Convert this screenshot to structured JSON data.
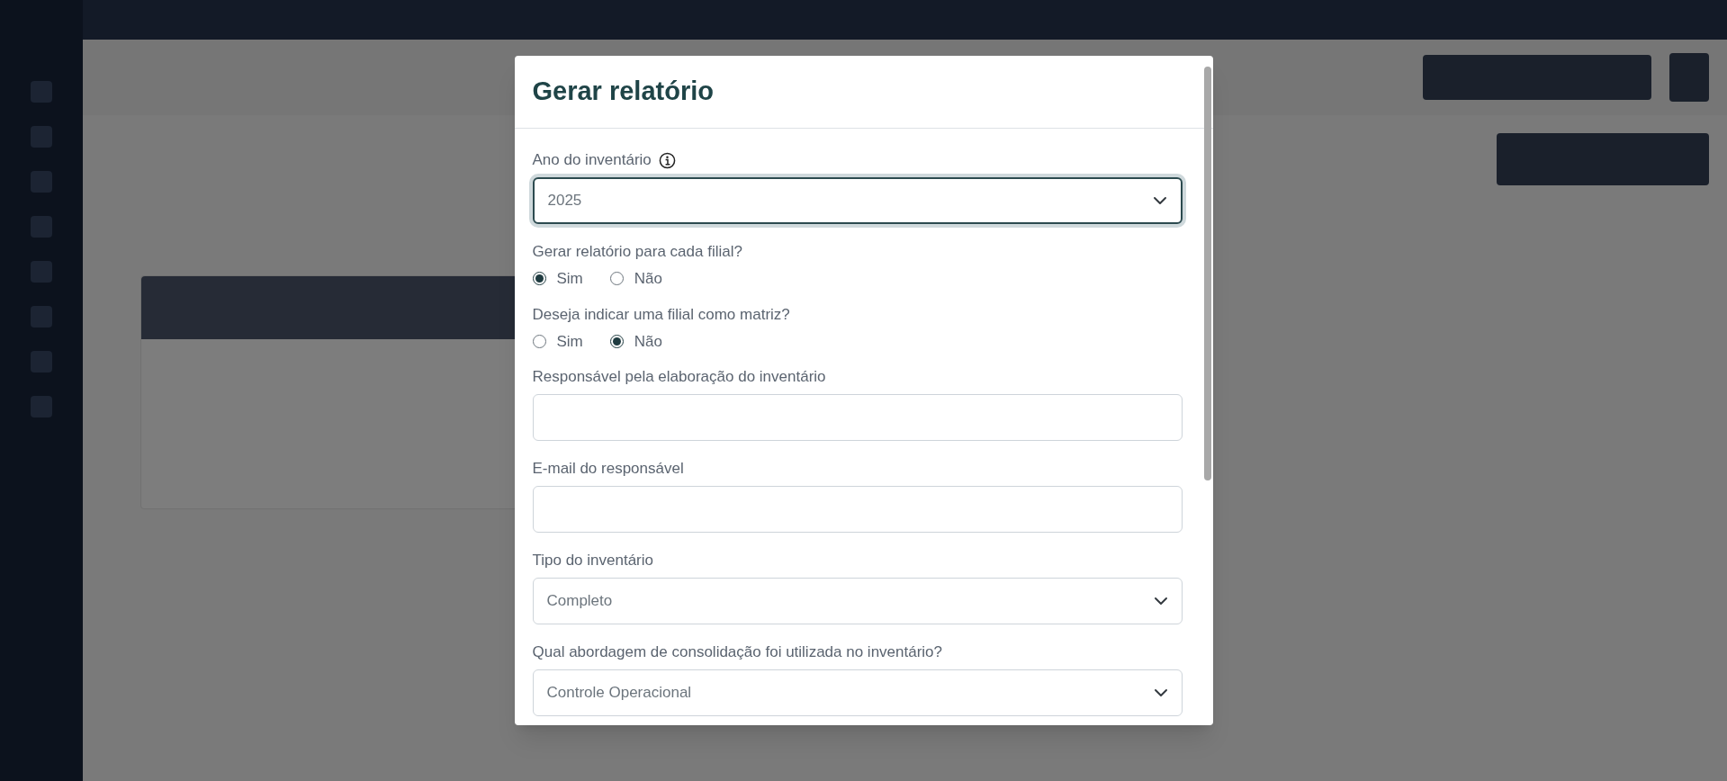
{
  "modal": {
    "title": "Gerar relatório",
    "fields": [
      {
        "kind": "select",
        "label": "Ano do inventário",
        "info": true,
        "value": "2025",
        "focused": true
      },
      {
        "kind": "radio",
        "label": "Gerar relatório para cada filial?",
        "options": [
          {
            "label": "Sim",
            "selected": true
          },
          {
            "label": "Não",
            "selected": false
          }
        ]
      },
      {
        "kind": "radio",
        "label": "Deseja indicar uma filial como matriz?",
        "options": [
          {
            "label": "Sim",
            "selected": false
          },
          {
            "label": "Não",
            "selected": true
          }
        ]
      },
      {
        "kind": "text",
        "label": "Responsável pela elaboração do inventário"
      },
      {
        "kind": "text",
        "label": "E-mail do responsável"
      },
      {
        "kind": "select",
        "label": "Tipo do inventário",
        "value": "Completo",
        "focused": false
      },
      {
        "kind": "select",
        "label": "Qual abordagem de consolidação foi utilizada no inventário?",
        "value": "Controle Operacional",
        "focused": false
      }
    ]
  }
}
